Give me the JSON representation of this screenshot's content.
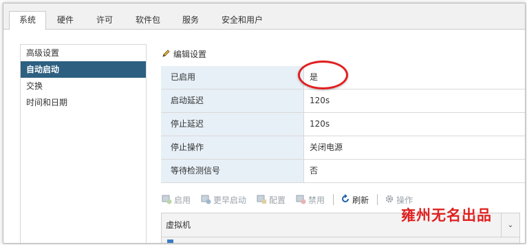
{
  "tabs": [
    "系统",
    "硬件",
    "许可",
    "软件包",
    "服务",
    "安全和用户"
  ],
  "sidebar": {
    "items": [
      "高级设置",
      "自动启动",
      "交换",
      "时间和日期"
    ],
    "active_index": 1
  },
  "edit_link": "编辑设置",
  "properties": [
    {
      "label": "已启用",
      "value": "是"
    },
    {
      "label": "启动延迟",
      "value": "120s"
    },
    {
      "label": "停止延迟",
      "value": "120s"
    },
    {
      "label": "停止操作",
      "value": "关闭电源"
    },
    {
      "label": "等待检测信号",
      "value": "否"
    }
  ],
  "toolbar": {
    "start": "启用",
    "priority": "更早启动",
    "config": "配置",
    "disable": "禁用",
    "refresh": "刷新",
    "actions": "操作"
  },
  "vm_panel": {
    "header": "虚拟机"
  },
  "watermark": "雍州无名出品",
  "colors": {
    "active_nav": "#2d5f80",
    "label_bg": "#e7f0f7",
    "highlight": "#e21e1e"
  }
}
